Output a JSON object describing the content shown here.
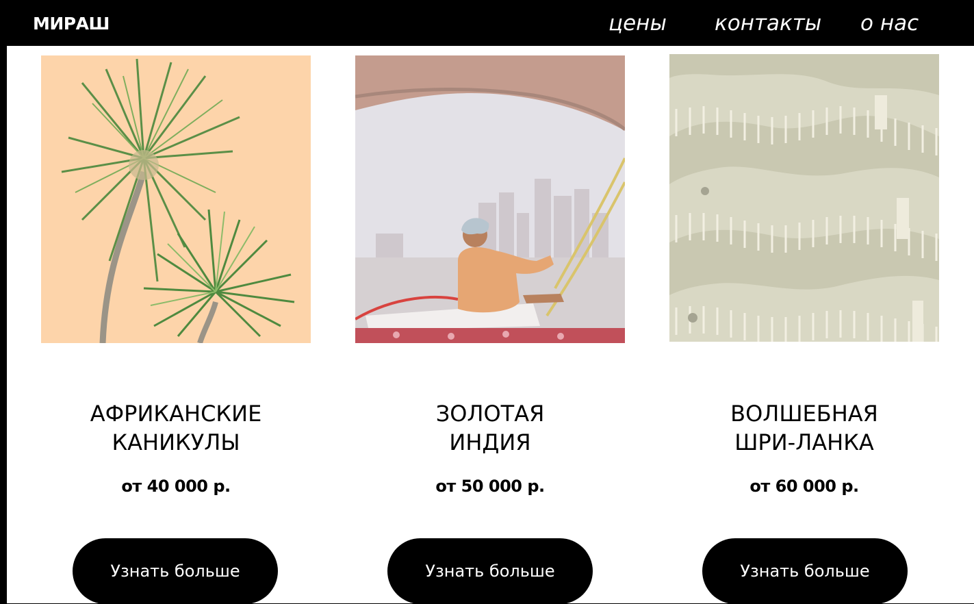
{
  "header": {
    "logo": "МИРАШ",
    "nav": [
      "цены",
      "контакты",
      "о нас"
    ]
  },
  "cards": [
    {
      "title_line1": "АФРИКАНСКИЕ",
      "title_line2": "КАНИКУЛЫ",
      "price": "от 40 000 р.",
      "button": "Узнать больше"
    },
    {
      "title_line1": "ЗОЛОТАЯ",
      "title_line2": "ИНДИЯ",
      "price": "от 50 000 р.",
      "button": "Узнать больше"
    },
    {
      "title_line1": "ВОЛШЕБНАЯ",
      "title_line2": "ШРИ-ЛАНКА",
      "price": "от 60 000 р.",
      "button": "Узнать больше"
    }
  ]
}
